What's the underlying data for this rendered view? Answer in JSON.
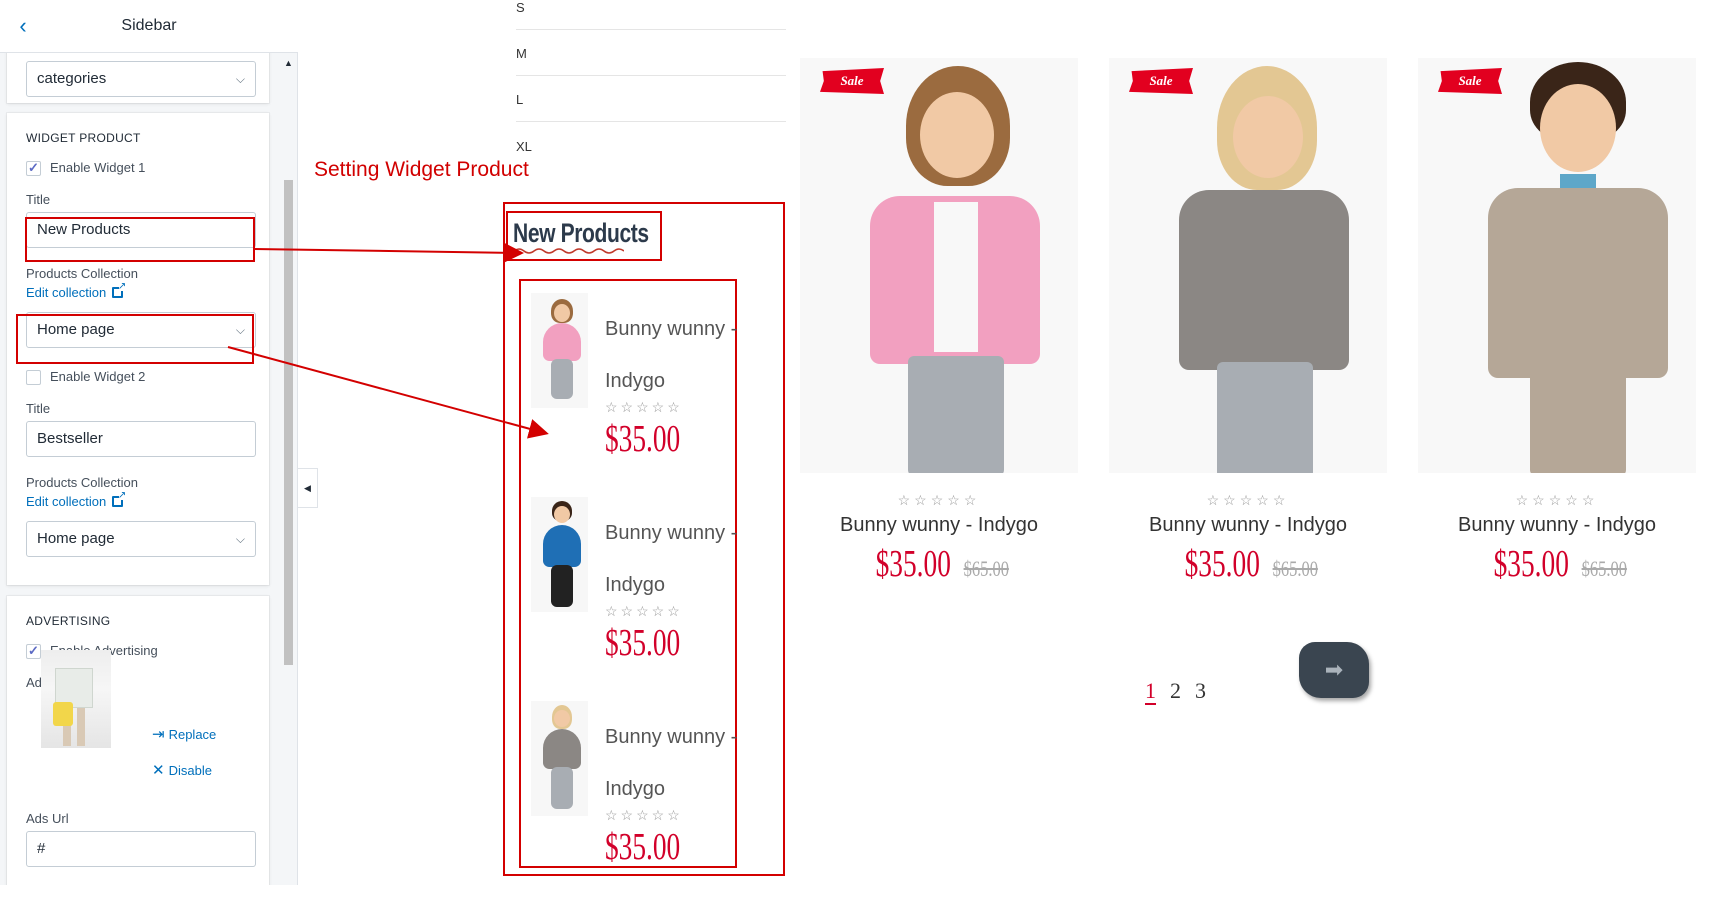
{
  "editor": {
    "title": "Sidebar",
    "categories_select": "categories",
    "widget_product": {
      "section_title": "WIDGET PRODUCT",
      "enable_widget_1_label": "Enable Widget 1",
      "enable_widget_1_checked": true,
      "title_label_1": "Title",
      "title_value_1": "New Products",
      "collection_label_1": "Products Collection",
      "edit_collection_1": "Edit collection",
      "collection_value_1": "Home page",
      "enable_widget_2_label": "Enable Widget 2",
      "enable_widget_2_checked": false,
      "title_label_2": "Title",
      "title_value_2": "Bestseller",
      "collection_label_2": "Products Collection",
      "edit_collection_2": "Edit collection",
      "collection_value_2": "Home page"
    },
    "advertising": {
      "section_title": "ADVERTISING",
      "enable_label": "Enable Advertising",
      "enable_checked": true,
      "ads_image_label": "Ads Image",
      "replace_label": "Replace",
      "disable_label": "Disable",
      "ads_url_label": "Ads Url",
      "ads_url_value": "#"
    }
  },
  "preview": {
    "sizes": [
      "S",
      "M",
      "L",
      "XL"
    ],
    "annotation": "Setting Widget Product",
    "widget_heading": "New Products",
    "widget_items": [
      {
        "name": "Bunny wunny - Indygo",
        "stars": "☆☆☆☆☆",
        "price": "$35.00"
      },
      {
        "name": "Bunny wunny - Indygo",
        "stars": "☆☆☆☆☆",
        "price": "$35.00"
      },
      {
        "name": "Bunny wunny - Indygo",
        "stars": "☆☆☆☆☆",
        "price": "$35.00"
      }
    ],
    "products": [
      {
        "badge": "Sale",
        "stars": "☆☆☆☆☆",
        "name": "Bunny wunny - Indygo",
        "price": "$35.00",
        "old_price": "$65.00"
      },
      {
        "badge": "Sale",
        "stars": "☆☆☆☆☆",
        "name": "Bunny wunny - Indygo",
        "price": "$35.00",
        "old_price": "$65.00"
      },
      {
        "badge": "Sale",
        "stars": "☆☆☆☆☆",
        "name": "Bunny wunny - Indygo",
        "price": "$35.00",
        "old_price": "$65.00"
      }
    ],
    "pagination": [
      "1",
      "2",
      "3"
    ],
    "current_page": 1,
    "next_icon": "arrow-right-icon"
  },
  "colors": {
    "annotation_red": "#d30000",
    "price_red": "#d2002a",
    "link_blue": "#006fbb",
    "sale_badge": "#e2001f"
  }
}
